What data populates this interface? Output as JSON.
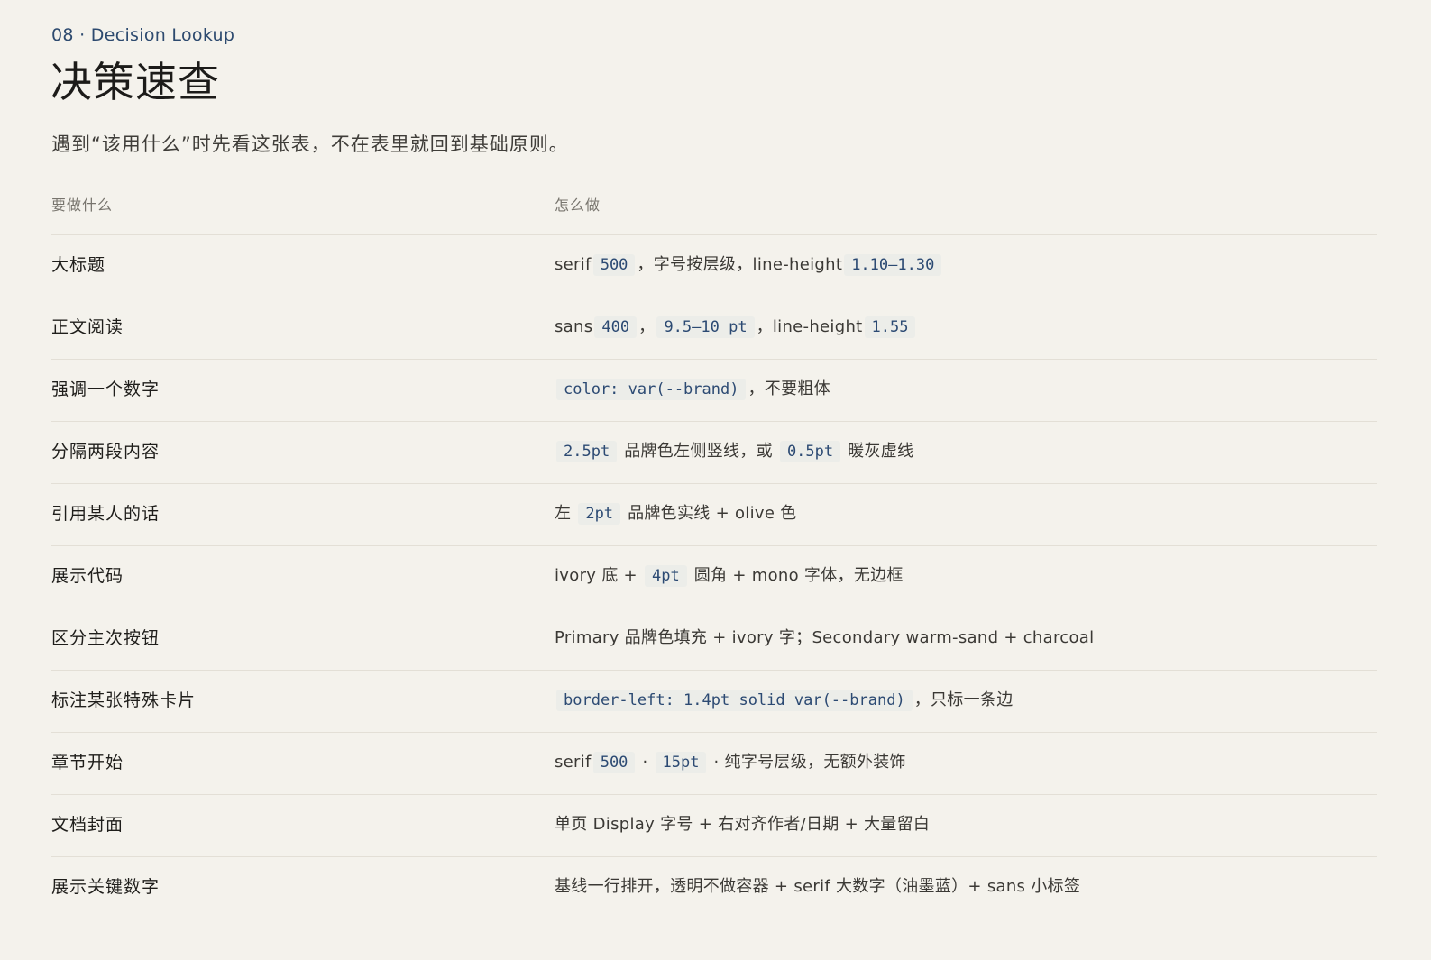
{
  "header": {
    "eyebrow": "08 · Decision Lookup",
    "title": "决策速查",
    "subtitle": "遇到“该用什么”时先看这张表，不在表里就回到基础原则。"
  },
  "table": {
    "headers": {
      "what": "要做什么",
      "how": "怎么做"
    },
    "rows": [
      {
        "what": "大标题",
        "how": [
          {
            "t": "text",
            "v": "serif"
          },
          {
            "t": "code",
            "v": "500"
          },
          {
            "t": "text",
            "v": "，字号按层级，line-height"
          },
          {
            "t": "code",
            "v": "1.10–1.30"
          }
        ]
      },
      {
        "what": "正文阅读",
        "how": [
          {
            "t": "text",
            "v": "sans"
          },
          {
            "t": "code",
            "v": "400"
          },
          {
            "t": "text",
            "v": "，"
          },
          {
            "t": "code",
            "v": "9.5–10 pt"
          },
          {
            "t": "text",
            "v": "，line-height"
          },
          {
            "t": "code",
            "v": "1.55"
          }
        ]
      },
      {
        "what": "强调一个数字",
        "how": [
          {
            "t": "code",
            "v": "color: var(--brand)"
          },
          {
            "t": "text",
            "v": "，不要粗体"
          }
        ]
      },
      {
        "what": "分隔两段内容",
        "how": [
          {
            "t": "code",
            "v": "2.5pt"
          },
          {
            "t": "text",
            "v": " 品牌色左侧竖线，或 "
          },
          {
            "t": "code",
            "v": "0.5pt"
          },
          {
            "t": "text",
            "v": " 暖灰虚线"
          }
        ]
      },
      {
        "what": "引用某人的话",
        "how": [
          {
            "t": "text",
            "v": "左 "
          },
          {
            "t": "code",
            "v": "2pt"
          },
          {
            "t": "text",
            "v": " 品牌色实线 + olive 色"
          }
        ]
      },
      {
        "what": "展示代码",
        "how": [
          {
            "t": "text",
            "v": "ivory 底 + "
          },
          {
            "t": "code",
            "v": "4pt"
          },
          {
            "t": "text",
            "v": " 圆角 + mono 字体，无边框"
          }
        ]
      },
      {
        "what": "区分主次按钮",
        "how": [
          {
            "t": "text",
            "v": "Primary 品牌色填充 + ivory 字；Secondary warm-sand + charcoal"
          }
        ]
      },
      {
        "what": "标注某张特殊卡片",
        "how": [
          {
            "t": "code",
            "v": "border-left: 1.4pt solid var(--brand)"
          },
          {
            "t": "text",
            "v": "，只标一条边"
          }
        ]
      },
      {
        "what": "章节开始",
        "how": [
          {
            "t": "text",
            "v": "serif"
          },
          {
            "t": "code",
            "v": "500"
          },
          {
            "t": "text",
            "v": " · "
          },
          {
            "t": "code",
            "v": "15pt"
          },
          {
            "t": "text",
            "v": " · 纯字号层级，无额外装饰"
          }
        ]
      },
      {
        "what": "文档封面",
        "how": [
          {
            "t": "text",
            "v": "单页 Display 字号 + 右对齐作者/日期 + 大量留白"
          }
        ]
      },
      {
        "what": "展示关键数字",
        "how": [
          {
            "t": "text",
            "v": "基线一行排开，透明不做容器 + serif 大数字（油墨蓝）+ sans 小标签"
          }
        ]
      }
    ]
  },
  "colors": {
    "background": "#f4f2ec",
    "brand_ink_blue": "#2c4a73",
    "code_background": "#ecede9",
    "rule": "#e3dfd6"
  }
}
